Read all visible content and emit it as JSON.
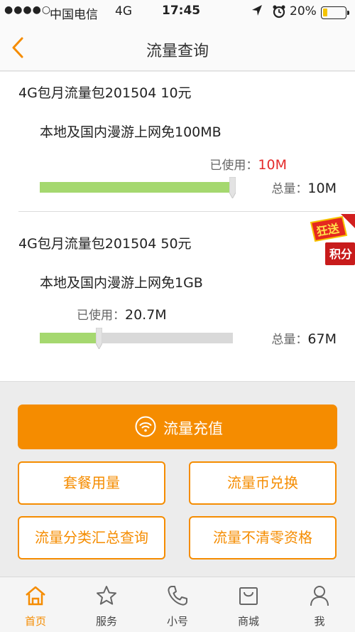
{
  "status_bar": {
    "signal": "●●●●○",
    "carrier": "中国电信",
    "network": "4G",
    "time": "17:45",
    "battery": "20%",
    "battery_level": 0.2,
    "battery_color": "#f5c400"
  },
  "nav": {
    "title": "流量查询",
    "back_icon": "chevron-left-icon"
  },
  "packages": [
    {
      "title": "4G包月流量包201504 10元",
      "desc": "本地及国内漫游上网免100MB",
      "used_label": "已使用：",
      "used_value": "10M",
      "total_label": "总量：",
      "total_value": "10M",
      "usage_fraction": 1.0
    },
    {
      "title": "4G包月流量包201504 50元",
      "desc": "本地及国内漫游上网免1GB",
      "used_label": "已使用：",
      "used_value": "20.7M",
      "total_label": "总量：",
      "total_value": "67M",
      "usage_fraction": 0.309
    }
  ],
  "badge": {
    "line1": "狂送",
    "line2": "积分"
  },
  "actions": {
    "recharge": "流量充值",
    "recharge_icon": "wifi-icon",
    "buttons": [
      "套餐用量",
      "流量币兑换",
      "流量分类汇总查询",
      "流量不清零资格"
    ]
  },
  "tabbar": {
    "items": [
      {
        "label": "首页",
        "icon": "home-icon",
        "active": true
      },
      {
        "label": "服务",
        "icon": "star-icon",
        "active": false
      },
      {
        "label": "小号",
        "icon": "phone-icon",
        "active": false
      },
      {
        "label": "商城",
        "icon": "shop-bag-icon",
        "active": false
      },
      {
        "label": "我",
        "icon": "user-icon",
        "active": false
      }
    ]
  },
  "colors": {
    "accent": "#f58c00",
    "used_over_limit": "#e42b2b",
    "bar_fill": "#a5d86f",
    "bar_track": "#d9d9d9"
  }
}
